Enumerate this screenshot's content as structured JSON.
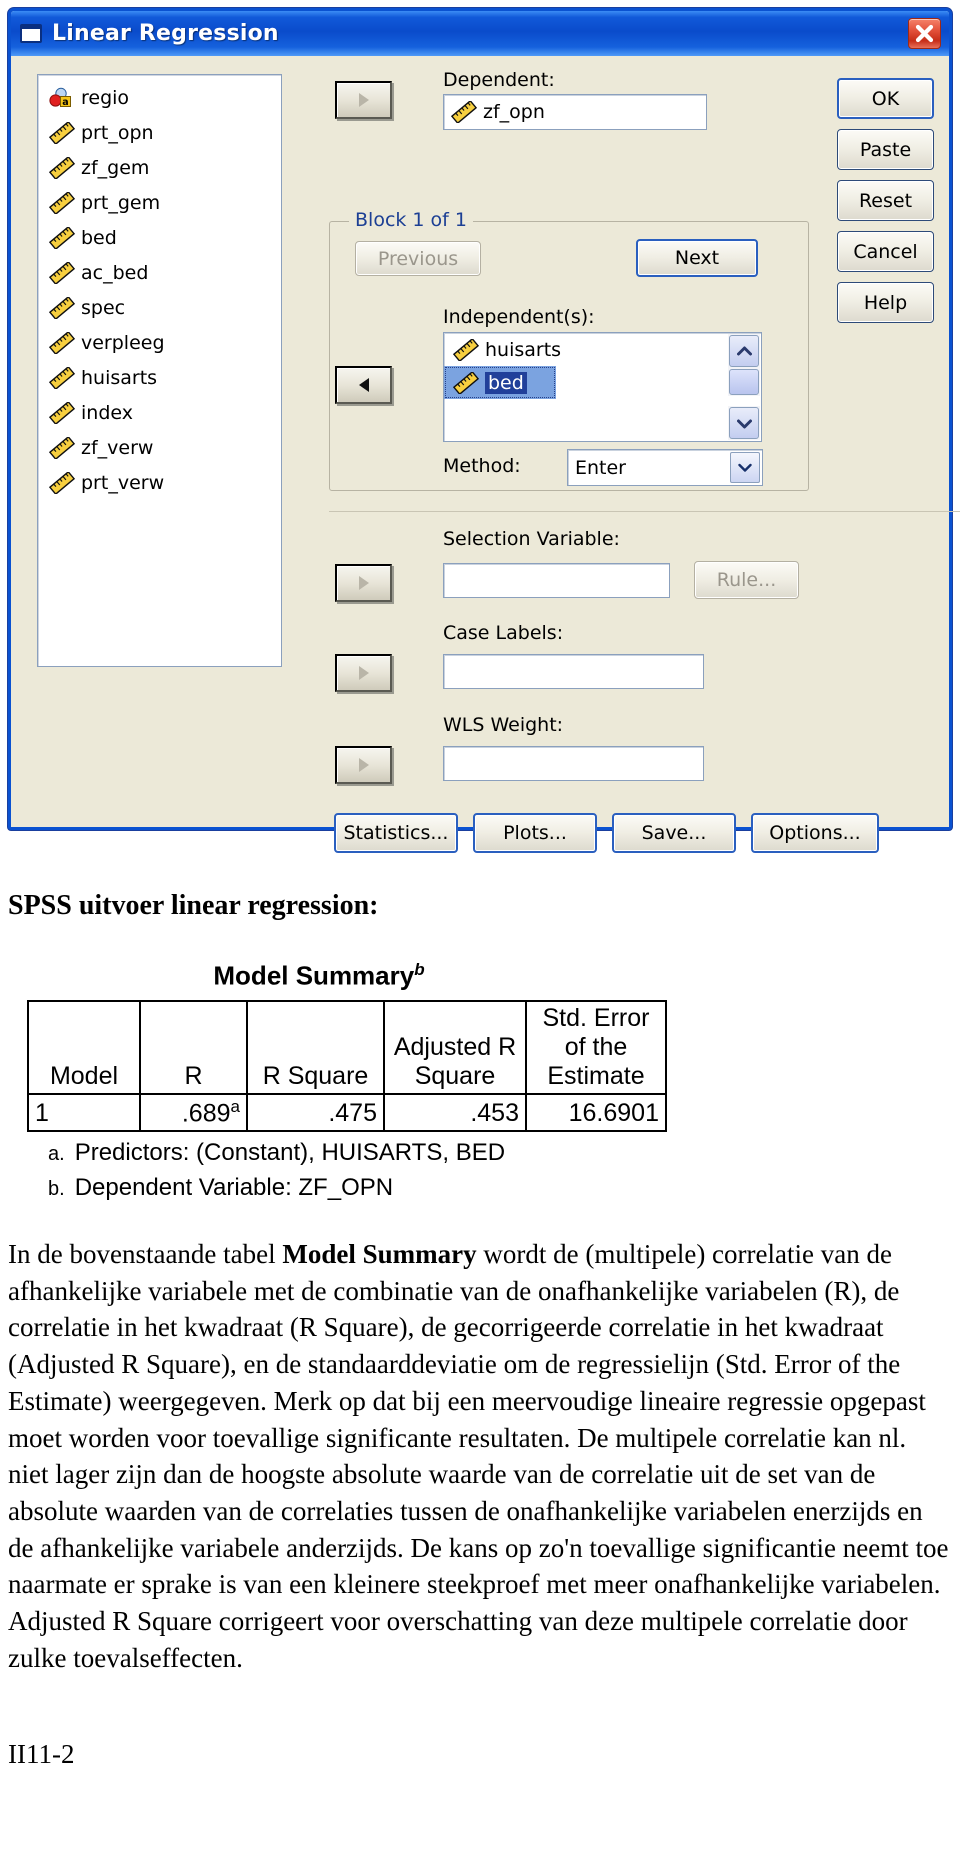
{
  "dialog": {
    "title": "Linear Regression",
    "close_icon": "close-icon",
    "source_variables": [
      {
        "name": "regio",
        "icon": "nominal-string-icon"
      },
      {
        "name": "prt_opn",
        "icon": "scale-ruler-icon"
      },
      {
        "name": "zf_gem",
        "icon": "scale-ruler-icon"
      },
      {
        "name": "prt_gem",
        "icon": "scale-ruler-icon"
      },
      {
        "name": "bed",
        "icon": "scale-ruler-icon"
      },
      {
        "name": "ac_bed",
        "icon": "scale-ruler-icon"
      },
      {
        "name": "spec",
        "icon": "scale-ruler-icon"
      },
      {
        "name": "verpleeg",
        "icon": "scale-ruler-icon"
      },
      {
        "name": "huisarts",
        "icon": "scale-ruler-icon"
      },
      {
        "name": "index",
        "icon": "scale-ruler-icon"
      },
      {
        "name": "zf_verw",
        "icon": "scale-ruler-icon"
      },
      {
        "name": "prt_verw",
        "icon": "scale-ruler-icon"
      }
    ],
    "dependent": {
      "label": "Dependent:",
      "value": "zf_opn"
    },
    "block": {
      "title": "Block 1 of 1",
      "previous_label": "Previous",
      "next_label": "Next",
      "independents_label": "Independent(s):",
      "independents": [
        {
          "name": "huisarts",
          "selected": false
        },
        {
          "name": "bed",
          "selected": true
        }
      ],
      "method_label": "Method:",
      "method_value": "Enter"
    },
    "selection_variable": {
      "label": "Selection Variable:",
      "value": "",
      "rule_label": "Rule..."
    },
    "case_labels": {
      "label": "Case Labels:",
      "value": ""
    },
    "wls_weight": {
      "label": "WLS Weight:",
      "value": ""
    },
    "action_buttons": [
      "OK",
      "Paste",
      "Reset",
      "Cancel",
      "Help"
    ],
    "bottom_buttons": [
      "Statistics...",
      "Plots...",
      "Save...",
      "Options..."
    ]
  },
  "document": {
    "heading": "SPSS uitvoer linear regression:",
    "table_title": "Model Summary",
    "table_title_sup": "b",
    "columns": [
      "Model",
      "R",
      "R Square",
      "Adjusted R Square",
      "Std. Error of the Estimate"
    ],
    "row": {
      "model": "1",
      "r": ".689",
      "r_sup": "a",
      "r_square": ".475",
      "adjusted_r_square": ".453",
      "std_error": "16.6901"
    },
    "footnotes": [
      {
        "mark": "a.",
        "text": "Predictors: (Constant), HUISARTS, BED"
      },
      {
        "mark": "b.",
        "text": "Dependent Variable: ZF_OPN"
      }
    ],
    "paragraph_1": "In de bovenstaande tabel ",
    "paragraph_bold": "Model Summary",
    "paragraph_2": " wordt de (multipele) correlatie van de afhankelijke variabele met de combinatie van de onafhankelijke variabelen (R), de correlatie in het kwadraat (R Square), de gecorrigeerde correlatie in het kwadraat (Adjusted R Square), en de standaarddeviatie om de regressielijn (Std. Error of the Estimate) weergegeven. Merk op dat bij een meervoudige lineaire regressie opgepast moet worden voor toevallige significante resultaten. De multipele correlatie kan nl. niet lager zijn dan de hoogste absolute waarde van de correlatie uit de set van de absolute waarden van de correlaties tussen de onafhankelijke variabelen enerzijds en de afhankelijke variabele anderzijds. De kans op zo'n toevallige significantie neemt toe naarmate er sprake is van een kleinere steekproef met meer onafhankelijke variabelen. Adjusted R Square corrigeert voor overschatting van deze multipele correlatie door zulke toevalseffecten.",
    "page_number": "II11-2"
  },
  "colors": {
    "title_blue": "#0a4bcb",
    "dialog_face": "#ece9d8",
    "selection_blue": "#21409a",
    "group_label_blue": "#1c3f94"
  },
  "chart_data": {
    "type": "table",
    "title": "Model Summary",
    "columns": [
      "Model",
      "R",
      "R Square",
      "Adjusted R Square",
      "Std. Error of the Estimate"
    ],
    "rows": [
      [
        "1",
        ".689a",
        ".475",
        ".453",
        "16.6901"
      ]
    ],
    "values": {
      "R": 0.689,
      "R_Square": 0.475,
      "Adjusted_R_Square": 0.453,
      "Std_Error_of_the_Estimate": 16.6901
    }
  }
}
